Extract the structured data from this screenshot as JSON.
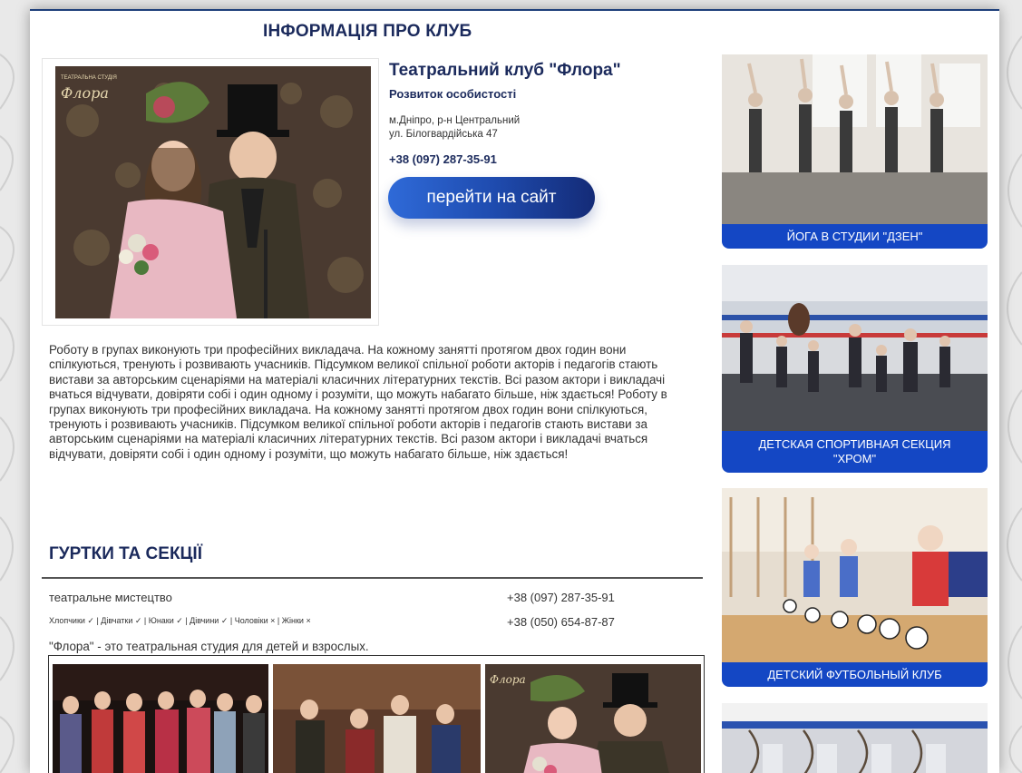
{
  "club_info": {
    "section_title": "ІНФОРМАЦІЯ ПРО КЛУБ",
    "name": "Театральний клуб \"Флора\"",
    "subtitle": "Розвиток особистості",
    "address_line1": "м.Дніпро, р-н Центральний",
    "address_line2": "ул. Білогвардійська 47",
    "phone": "+38 (097) 287-35-91",
    "site_button": "перейти на сайт",
    "photo_logo": "Флора",
    "photo_studio": "ТЕАТРАЛЬНА СТУДІЯ",
    "description": "Роботу в групах виконують три професійних викладача. На кожному занятті протягом двох годин вони спілкуються, тренують і розвивають учасників. Підсумком великої спільної роботи акторів і педагогів стають вистави за авторським сценаріями на матеріалі класичних літературних текстів. Всі разом актори і викладачі вчаться відчувати, довіряти собі і один одному і розуміти, що можуть набагато більше, ніж здається! Роботу в групах виконують три професійних викладача. На кожному занятті протягом двох годин вони спілкуються, тренують і розвивають учасників. Підсумком великої спільної роботи акторів і педагогів стають вистави за авторським сценаріями на матеріалі класичних літературних текстів. Всі разом актори і викладачі вчаться відчувати, довіряти собі і один одному і розуміти, що можуть набагато більше, ніж здається!"
  },
  "sections": {
    "title": "ГУРТКИ ТА СЕКЦІЇ",
    "item": {
      "name": "театральне мистецтво",
      "tags": "Хлопчики ✓ | Дівчатки ✓ | Юнаки ✓ | Дівчини ✓ | Чоловіки × | Жінки ×",
      "phone1": "+38 (097) 287-35-91",
      "phone2": "+38 (050) 654-87-87",
      "description": "\"Флора\" - это театральная студия для детей и взрослых."
    }
  },
  "sidebar": {
    "cards": [
      {
        "label": "ЙОГА В СТУДИИ \"ДЗЕН\""
      },
      {
        "label": "ДЕТСКАЯ СПОРТИВНАЯ СЕКЦИЯ \"ХРОМ\""
      },
      {
        "label": "ДЕТСКИЙ ФУТБОЛЬНЫЙ КЛУБ"
      },
      {
        "label": ""
      }
    ]
  },
  "colors": {
    "accent": "#1447c4",
    "title": "#1b2a5c",
    "button_start": "#2f6ad8",
    "button_end": "#142b77"
  }
}
